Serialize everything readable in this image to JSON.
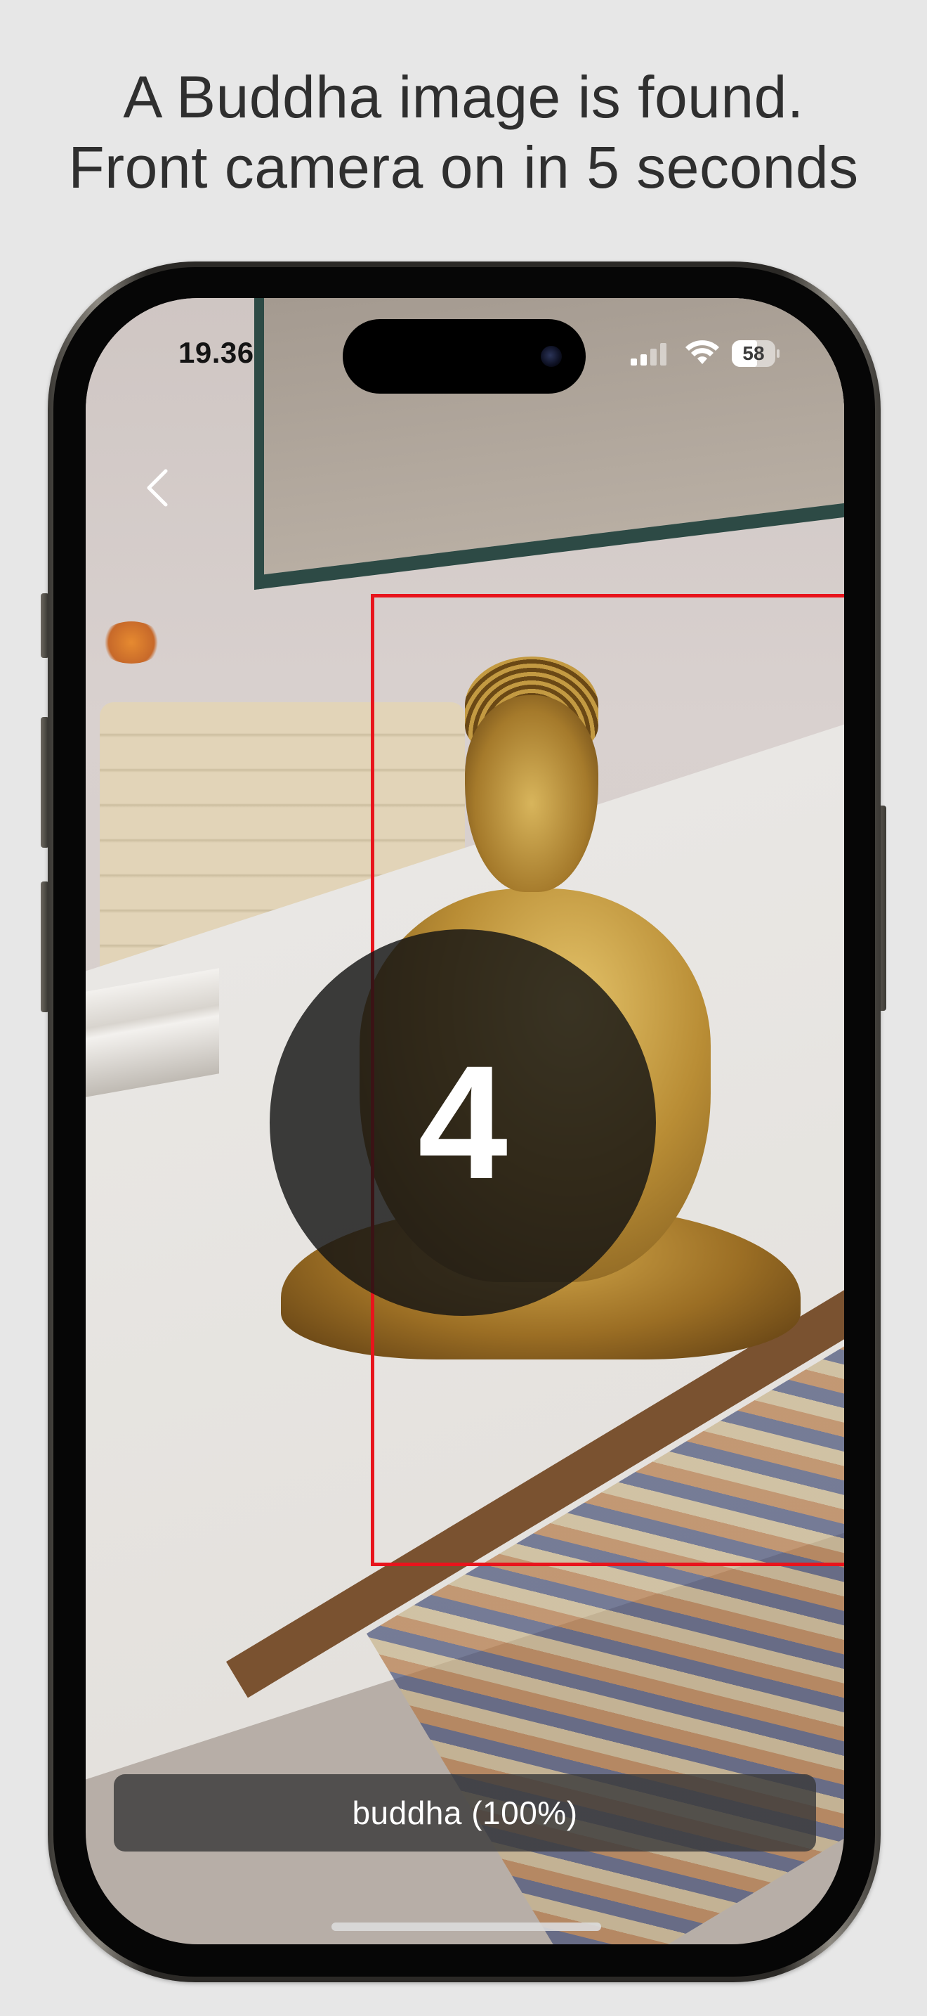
{
  "caption": {
    "line1": "A Buddha image is found.",
    "line2": "Front camera on in 5 seconds"
  },
  "status_bar": {
    "time": "19.36",
    "battery_level": "58",
    "icons": [
      "signal-icon",
      "wifi-icon",
      "battery-icon"
    ]
  },
  "navigation": {
    "back_icon": "chevron-left-icon"
  },
  "countdown": {
    "value": "4"
  },
  "detection": {
    "label": "buddha (100%)",
    "box_color": "#e8141c"
  },
  "colors": {
    "background": "#e7e7e7",
    "caption_text": "#2f2f2f",
    "countdown_circle": "#141414",
    "label_bar": "#3a3a3a"
  }
}
